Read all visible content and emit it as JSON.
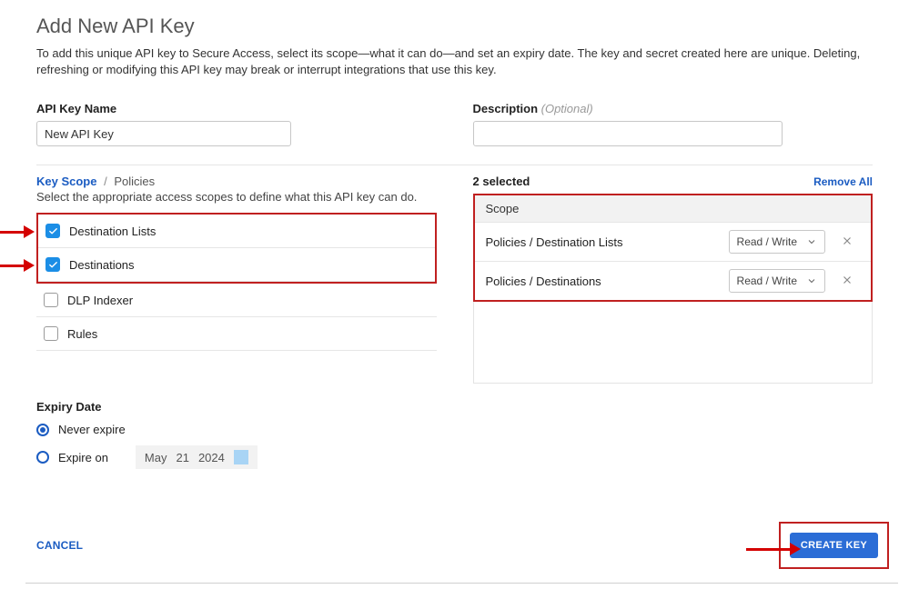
{
  "page": {
    "title": "Add New API Key",
    "description": "To add this unique API key to Secure Access, select its scope—what it can do—and set an expiry date. The key and secret created here are unique. Deleting, refreshing or modifying this API key may break or interrupt integrations that use this key."
  },
  "form": {
    "api_key_name_label": "API Key Name",
    "api_key_name_value": "New API Key",
    "description_label": "Description",
    "description_optional": "(Optional)",
    "description_value": ""
  },
  "scope": {
    "breadcrumb_root": "Key Scope",
    "breadcrumb_leaf": "Policies",
    "hint": "Select the appropriate access scopes to define what this API key can do.",
    "items": [
      {
        "label": "Destination Lists",
        "checked": true
      },
      {
        "label": "Destinations",
        "checked": true
      },
      {
        "label": "DLP Indexer",
        "checked": false
      },
      {
        "label": "Rules",
        "checked": false
      }
    ]
  },
  "selected": {
    "count_label": "2 selected",
    "remove_all": "Remove All",
    "header": "Scope",
    "rows": [
      {
        "name": "Policies / Destination Lists",
        "perm": "Read / Write"
      },
      {
        "name": "Policies / Destinations",
        "perm": "Read / Write"
      }
    ]
  },
  "expiry": {
    "label": "Expiry Date",
    "never": "Never expire",
    "expire_on": "Expire on",
    "date_month": "May",
    "date_day": "21",
    "date_year": "2024",
    "selected": "never"
  },
  "actions": {
    "cancel": "CANCEL",
    "create": "CREATE KEY"
  }
}
